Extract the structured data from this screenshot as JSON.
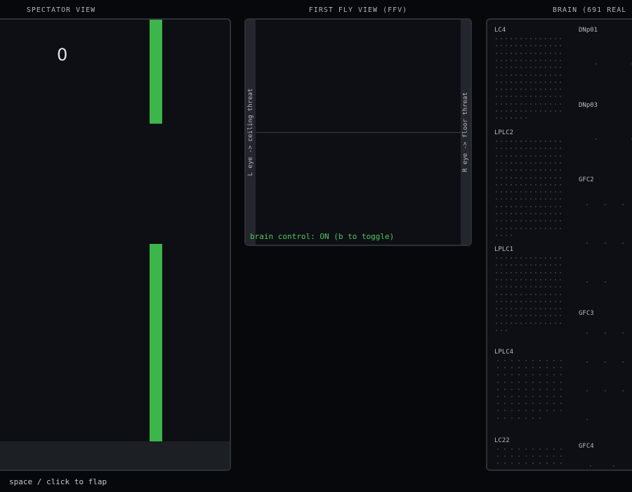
{
  "panels": {
    "spectator_title": "SPECTATOR VIEW",
    "ffv_title": "FIRST FLY VIEW (FFV)",
    "brain_title": "BRAIN (691 REAL"
  },
  "spectator": {
    "score": "0"
  },
  "ffv": {
    "left_eye_label": "L eye -> ceiling threat",
    "right_eye_label": "R eye -> floor threat",
    "brain_control_status": "brain control: ON (b to toggle)"
  },
  "brain": {
    "groups": {
      "lc4": "LC4",
      "lplc2": "LPLC2",
      "lplc1": "LPLC1",
      "lplc4": "LPLC4",
      "lc22": "LC22",
      "dnp01": "DNp01",
      "dnp03": "DNp03",
      "gfc2": "GFC2",
      "gfc3": "GFC3",
      "gfc4": "GFC4"
    }
  },
  "footer": {
    "hint": "space / click to flap"
  },
  "colors": {
    "pipe": "#3cb54a",
    "status_text": "#4fc761",
    "panel_bg": "#0d0f14",
    "page_bg": "#07080b"
  }
}
